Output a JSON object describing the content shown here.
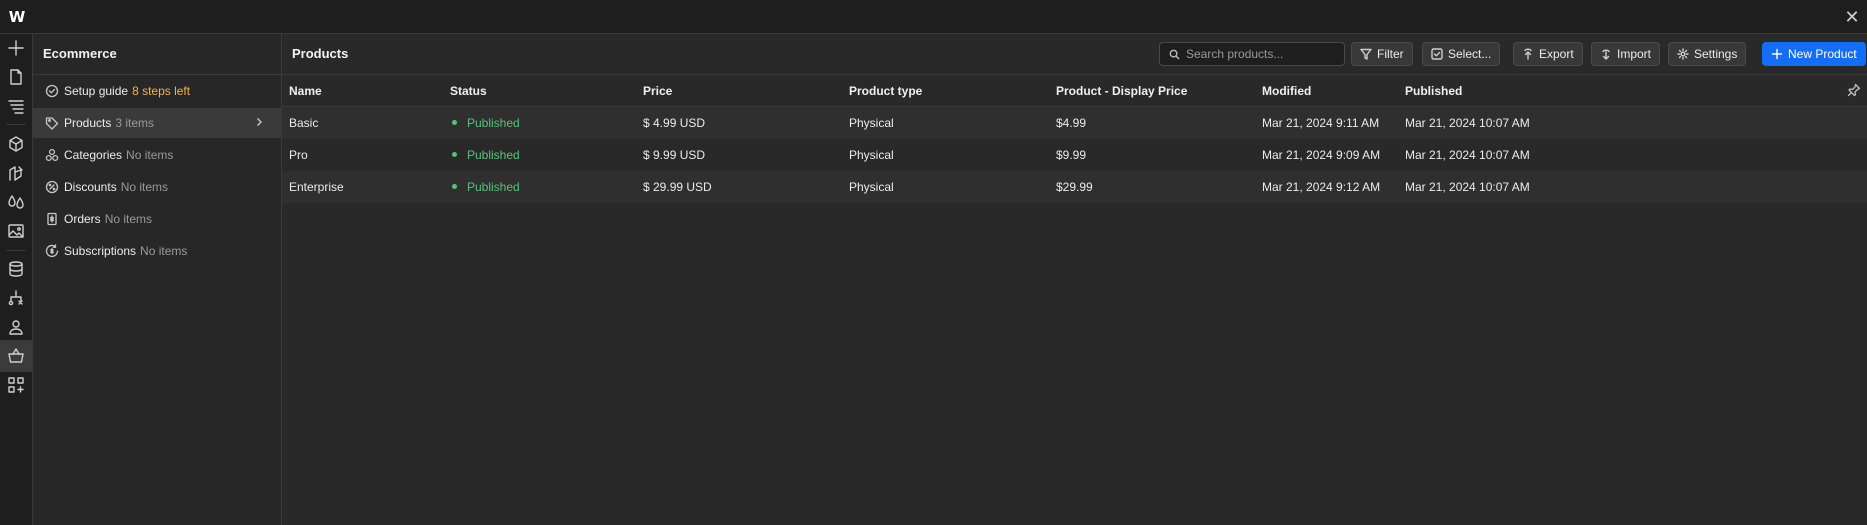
{
  "panel": {
    "title": "Ecommerce",
    "items": [
      {
        "label": "Setup guide",
        "count": "8 steps left"
      },
      {
        "label": "Products",
        "count": "3 items"
      },
      {
        "label": "Categories",
        "count": "No items"
      },
      {
        "label": "Discounts",
        "count": "No items"
      },
      {
        "label": "Orders",
        "count": "No items"
      },
      {
        "label": "Subscriptions",
        "count": "No items"
      }
    ]
  },
  "main": {
    "title": "Products",
    "search_placeholder": "Search products...",
    "buttons": {
      "filter": "Filter",
      "select": "Select...",
      "export": "Export",
      "import": "Import",
      "settings": "Settings",
      "new_product": "New Product"
    },
    "columns": [
      "Name",
      "Status",
      "Price",
      "Product type",
      "Product - Display Price",
      "Modified",
      "Published"
    ],
    "rows": [
      {
        "name": "Basic",
        "status": "Published",
        "price": "$ 4.99 USD",
        "type": "Physical",
        "display_price": "$4.99",
        "modified": "Mar 21, 2024 9:11 AM",
        "published": "Mar 21, 2024 10:07 AM"
      },
      {
        "name": "Pro",
        "status": "Published",
        "price": "$ 9.99 USD",
        "type": "Physical",
        "display_price": "$9.99",
        "modified": "Mar 21, 2024 9:09 AM",
        "published": "Mar 21, 2024 10:07 AM"
      },
      {
        "name": "Enterprise",
        "status": "Published",
        "price": "$ 29.99 USD",
        "type": "Physical",
        "display_price": "$29.99",
        "modified": "Mar 21, 2024 9:12 AM",
        "published": "Mar 21, 2024 10:07 AM"
      }
    ]
  },
  "colors": {
    "accent": "#146ef5",
    "status_published": "#59c27a",
    "warning": "#f2b43f"
  },
  "icons": {
    "brand": "webflow-logo",
    "close": "close-icon"
  },
  "brand_mark": "W"
}
